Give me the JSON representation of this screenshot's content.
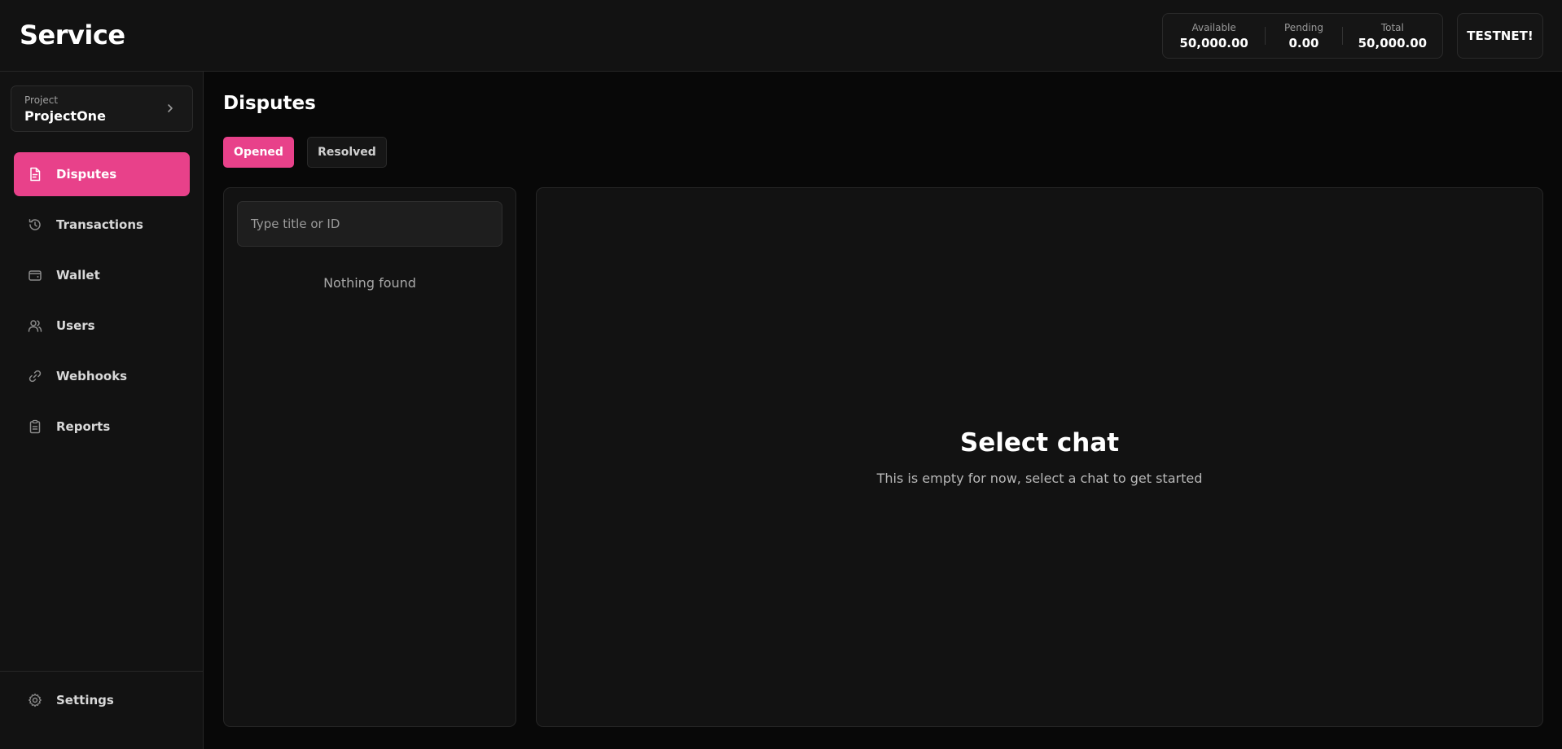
{
  "header": {
    "brand": "Service",
    "balances": [
      {
        "label": "Available",
        "value": "50,000.00"
      },
      {
        "label": "Pending",
        "value": "0.00"
      },
      {
        "label": "Total",
        "value": "50,000.00"
      }
    ],
    "network_button": "TESTNET!"
  },
  "sidebar": {
    "project": {
      "label": "Project",
      "name": "ProjectOne",
      "icon": "chevron-right-icon"
    },
    "items": [
      {
        "label": "Disputes",
        "icon": "document-icon",
        "active": true
      },
      {
        "label": "Transactions",
        "icon": "history-icon",
        "active": false
      },
      {
        "label": "Wallet",
        "icon": "wallet-icon",
        "active": false
      },
      {
        "label": "Users",
        "icon": "users-icon",
        "active": false
      },
      {
        "label": "Webhooks",
        "icon": "link-icon",
        "active": false
      },
      {
        "label": "Reports",
        "icon": "clipboard-icon",
        "active": false
      }
    ],
    "settings": {
      "label": "Settings",
      "icon": "gear-icon"
    }
  },
  "main": {
    "title": "Disputes",
    "tabs": [
      {
        "label": "Opened",
        "active": true
      },
      {
        "label": "Resolved",
        "active": false
      }
    ],
    "search": {
      "placeholder": "Type title or ID",
      "value": ""
    },
    "empty_list": "Nothing found",
    "chat": {
      "title": "Select chat",
      "subtitle": "This is empty for now, select a chat to get started"
    }
  },
  "colors": {
    "accent": "#e8418a",
    "background": "#080808",
    "panel": "#121212",
    "border": "#262626"
  }
}
